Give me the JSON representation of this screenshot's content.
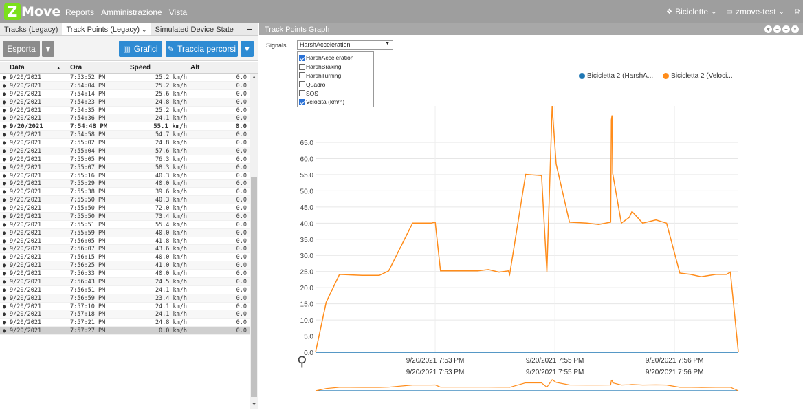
{
  "topbar": {
    "logo_z": "Z",
    "logo_word": "Move",
    "menu": [
      "Reports",
      "Amministrazione",
      "Vista"
    ],
    "group_label": "Biciclette",
    "account_label": "zmove-test"
  },
  "left": {
    "tabs": [
      "Tracks (Legacy)",
      "Track Points (Legacy)",
      "Simulated Device State"
    ],
    "export_label": "Esporta",
    "charts_label": "Grafici",
    "trace_label": "Traccia percorsi",
    "columns": [
      "Data",
      "Ora",
      "Speed",
      "Alt"
    ],
    "rows": [
      [
        "9/20/2021",
        "7:53:52 PM",
        "25.2 km/h",
        "0.0"
      ],
      [
        "9/20/2021",
        "7:54:04 PM",
        "25.2 km/h",
        "0.0"
      ],
      [
        "9/20/2021",
        "7:54:14 PM",
        "25.6 km/h",
        "0.0"
      ],
      [
        "9/20/2021",
        "7:54:23 PM",
        "24.8 km/h",
        "0.0"
      ],
      [
        "9/20/2021",
        "7:54:35 PM",
        "25.2 km/h",
        "0.0"
      ],
      [
        "9/20/2021",
        "7:54:36 PM",
        "24.1 km/h",
        "0.0"
      ],
      [
        "9/20/2021",
        "7:54:48 PM",
        "55.1 km/h",
        "0.0"
      ],
      [
        "9/20/2021",
        "7:54:58 PM",
        "54.7 km/h",
        "0.0"
      ],
      [
        "9/20/2021",
        "7:55:02 PM",
        "24.8 km/h",
        "0.0"
      ],
      [
        "9/20/2021",
        "7:55:04 PM",
        "57.6 km/h",
        "0.0"
      ],
      [
        "9/20/2021",
        "7:55:05 PM",
        "76.3 km/h",
        "0.0"
      ],
      [
        "9/20/2021",
        "7:55:07 PM",
        "58.3 km/h",
        "0.0"
      ],
      [
        "9/20/2021",
        "7:55:16 PM",
        "40.3 km/h",
        "0.0"
      ],
      [
        "9/20/2021",
        "7:55:29 PM",
        "40.0 km/h",
        "0.0"
      ],
      [
        "9/20/2021",
        "7:55:38 PM",
        "39.6 km/h",
        "0.0"
      ],
      [
        "9/20/2021",
        "7:55:50 PM",
        "40.3 km/h",
        "0.0"
      ],
      [
        "9/20/2021",
        "7:55:50 PM",
        "72.0 km/h",
        "0.0"
      ],
      [
        "9/20/2021",
        "7:55:50 PM",
        "73.4 km/h",
        "0.0"
      ],
      [
        "9/20/2021",
        "7:55:51 PM",
        "55.4 km/h",
        "0.0"
      ],
      [
        "9/20/2021",
        "7:55:59 PM",
        "40.0 km/h",
        "0.0"
      ],
      [
        "9/20/2021",
        "7:56:05 PM",
        "41.8 km/h",
        "0.0"
      ],
      [
        "9/20/2021",
        "7:56:07 PM",
        "43.6 km/h",
        "0.0"
      ],
      [
        "9/20/2021",
        "7:56:15 PM",
        "40.0 km/h",
        "0.0"
      ],
      [
        "9/20/2021",
        "7:56:25 PM",
        "41.0 km/h",
        "0.0"
      ],
      [
        "9/20/2021",
        "7:56:33 PM",
        "40.0 km/h",
        "0.0"
      ],
      [
        "9/20/2021",
        "7:56:43 PM",
        "24.5 km/h",
        "0.0"
      ],
      [
        "9/20/2021",
        "7:56:51 PM",
        "24.1 km/h",
        "0.0"
      ],
      [
        "9/20/2021",
        "7:56:59 PM",
        "23.4 km/h",
        "0.0"
      ],
      [
        "9/20/2021",
        "7:57:10 PM",
        "24.1 km/h",
        "0.0"
      ],
      [
        "9/20/2021",
        "7:57:18 PM",
        "24.1 km/h",
        "0.0"
      ],
      [
        "9/20/2021",
        "7:57:21 PM",
        "24.8 km/h",
        "0.0"
      ],
      [
        "9/20/2021",
        "7:57:27 PM",
        "0.0 km/h",
        "0.0"
      ]
    ],
    "bold_row": 6,
    "selected_row": 31
  },
  "right": {
    "title": "Track Points Graph",
    "signals_label": "Signals",
    "selected_signal": "HarshAcceleration",
    "options": [
      {
        "label": "HarshAcceleration",
        "checked": true
      },
      {
        "label": "HarshBraking",
        "checked": false
      },
      {
        "label": "HarshTurning",
        "checked": false
      },
      {
        "label": "Quadro",
        "checked": false
      },
      {
        "label": "SOS",
        "checked": false
      },
      {
        "label": "Velocità (km/h)",
        "checked": true
      }
    ]
  },
  "chart_data": {
    "type": "line",
    "legend": [
      "Bicicletta 2 (HarshA...",
      "Bicicletta 2 (Veloci..."
    ],
    "legend_position": "top-right",
    "colors": {
      "harsh": "#1f77b4",
      "speed": "#ff8c1a"
    },
    "y_ticks": [
      "0.0",
      "5.0",
      "10.0",
      "15.0",
      "20.0",
      "25.0",
      "30.0",
      "35.0",
      "40.0",
      "45.0",
      "50.0",
      "55.0",
      "60.0",
      "65.0"
    ],
    "ylim": [
      0,
      76.3
    ],
    "x_ticks": [
      "9/20/2021 7:53 PM",
      "9/20/2021 7:55 PM",
      "9/20/2021 7:56 PM"
    ],
    "speed_points": [
      [
        "19:52:30",
        0
      ],
      [
        "19:52:38",
        15.5
      ],
      [
        "19:52:48",
        24.1
      ],
      [
        "19:53:05",
        23.8
      ],
      [
        "19:53:18",
        23.8
      ],
      [
        "19:53:25",
        25.2
      ],
      [
        "19:53:43",
        40.0
      ],
      [
        "19:53:57",
        40.0
      ],
      [
        "19:54:00",
        40.3
      ],
      [
        "19:54:04",
        25.2
      ],
      [
        "19:54:14",
        25.2
      ],
      [
        "19:54:23",
        25.2
      ],
      [
        "19:54:32",
        25.2
      ],
      [
        "19:54:40",
        25.6
      ],
      [
        "19:54:48",
        24.8
      ],
      [
        "19:54:55",
        25.2
      ],
      [
        "19:54:56",
        24.1
      ],
      [
        "19:55:08",
        55.1
      ],
      [
        "19:55:20",
        54.7
      ],
      [
        "19:55:24",
        24.8
      ],
      [
        "19:55:28",
        76.3
      ],
      [
        "19:55:31",
        58.3
      ],
      [
        "19:55:41",
        40.3
      ],
      [
        "19:55:54",
        40.0
      ],
      [
        "19:56:03",
        39.6
      ],
      [
        "19:56:12",
        40.3
      ],
      [
        "19:56:12.5",
        72.0
      ],
      [
        "19:56:13",
        73.4
      ],
      [
        "19:56:13.5",
        55.4
      ],
      [
        "19:56:20",
        40.0
      ],
      [
        "19:56:26",
        41.8
      ],
      [
        "19:56:28",
        43.6
      ],
      [
        "19:56:36",
        40.0
      ],
      [
        "19:56:46",
        41.0
      ],
      [
        "19:56:54",
        40.0
      ],
      [
        "19:57:04",
        24.5
      ],
      [
        "19:57:12",
        24.1
      ],
      [
        "19:57:20",
        23.4
      ],
      [
        "19:57:31",
        24.1
      ],
      [
        "19:57:39",
        24.1
      ],
      [
        "19:57:42",
        24.8
      ],
      [
        "19:57:48",
        0.0
      ]
    ],
    "harsh_values": [
      0
    ]
  }
}
